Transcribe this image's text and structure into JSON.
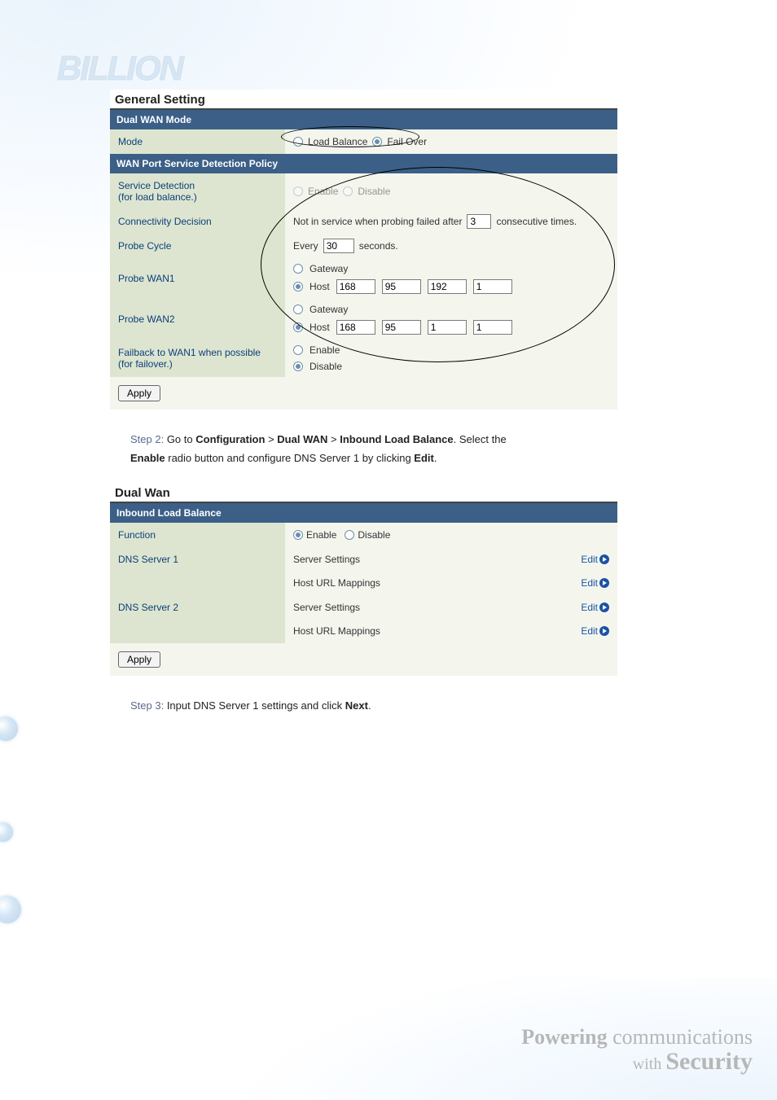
{
  "brand": "BILLION",
  "panel1": {
    "title": "General Setting",
    "dual_wan_mode_header": "Dual WAN Mode",
    "mode_label": "Mode",
    "mode_load_balance": "Load Balance",
    "mode_fail_over": "Fail Over",
    "wan_policy_header": "WAN Port Service Detection Policy",
    "service_detection_label": "Service Detection\n(for load balance.)",
    "enable": "Enable",
    "disable": "Disable",
    "conn_decision_label": "Connectivity Decision",
    "conn_text_a": "Not in service when probing failed after",
    "conn_val": "3",
    "conn_text_b": "consecutive times.",
    "probe_cycle_label": "Probe Cycle",
    "probe_every": "Every",
    "probe_cycle_val": "30",
    "probe_seconds": "seconds.",
    "probe_wan1_label": "Probe WAN1",
    "probe_wan2_label": "Probe WAN2",
    "gateway": "Gateway",
    "host": "Host",
    "wan1_ip": [
      "168",
      "95",
      "192",
      "1"
    ],
    "wan2_ip": [
      "168",
      "95",
      "1",
      "1"
    ],
    "failback_label": "Failback to WAN1 when possible\n(for failover.)",
    "apply": "Apply"
  },
  "step2": {
    "lead": "Step 2:",
    "t1": " Go to ",
    "b1": "Configuration",
    "gt": " > ",
    "b2": "Dual WAN",
    "b3": "Inbound Load Balance",
    "t2": ". Select the ",
    "b4": "Enable",
    "t3": " radio button and configure DNS Server 1 by clicking ",
    "b5": "Edit",
    "t4": "."
  },
  "panel2": {
    "title": "Dual Wan",
    "header": "Inbound Load Balance",
    "function_label": "Function",
    "enable": "Enable",
    "disable": "Disable",
    "dns1": "DNS Server 1",
    "dns2": "DNS Server 2",
    "server_settings": "Server Settings",
    "host_url": "Host URL Mappings",
    "edit": "Edit",
    "apply": "Apply"
  },
  "step3": {
    "lead": "Step 3:",
    "t1": " Input DNS Server 1 settings and click ",
    "b1": "Next",
    "t2": "."
  },
  "footer": {
    "l1a": "Powering",
    "l1b": " communications",
    "l2a": "with ",
    "l2b": "Security"
  }
}
